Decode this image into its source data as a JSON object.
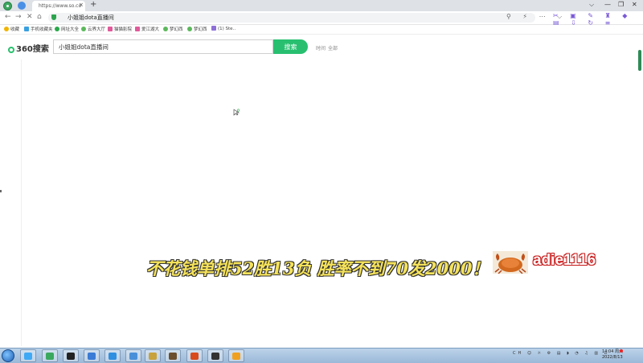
{
  "browser": {
    "tab_title": "https://www.so.co",
    "tab_close": "×",
    "new_tab": "+",
    "address_url": "小姐姐dota直播间",
    "window_controls": [
      "⌵",
      "—",
      "❐",
      "✕"
    ],
    "nav": {
      "back": "←",
      "forward": "→",
      "reload": "✕",
      "home": "⌂"
    },
    "omni_icons": "⚲ ⚡ ⋯ ⌵",
    "toolbar_icons": "✂ ▣ ✎ ♜ ◆ ▤ ⇩ ↻ ≡"
  },
  "bookmarks": [
    {
      "label": "收藏",
      "color": "#f0b400"
    },
    {
      "label": "手机收藏夹",
      "color": "#39a0e0"
    },
    {
      "label": "网址大全",
      "color": "#2aa84a"
    },
    {
      "label": "云界大厅",
      "color": "#5cb85c"
    },
    {
      "label": "猫猫影院",
      "color": "#e05a9a"
    },
    {
      "label": "爱江湖大",
      "color": "#e05a9a"
    },
    {
      "label": "梦幻西",
      "color": "#5cb85c"
    },
    {
      "label": "梦幻西",
      "color": "#5cb85c"
    },
    {
      "label": "(1) Ste..",
      "color": "#8e6fd6"
    }
  ],
  "search": {
    "logo": "360搜索",
    "query": "小姐姐dota直播间",
    "button": "搜索",
    "filter_time": "时间",
    "filter_all": "全部"
  },
  "overlay": {
    "caption": "不花钱单排52胜13负 胜率不到70发2000！",
    "streamer": "adie1116"
  },
  "taskbar": {
    "apps": [
      {
        "icon": "ie-icon",
        "color": "#3fa9f5"
      },
      {
        "icon": "browser-icon",
        "color": "#3ba85f"
      },
      {
        "icon": "media-icon",
        "color": "#222222"
      },
      {
        "icon": "mail-icon",
        "color": "#3a7bd5"
      },
      {
        "icon": "cloud-icon",
        "color": "#2f8fe0"
      },
      {
        "icon": "folder-icon",
        "color": "#4a90d9"
      },
      {
        "icon": "game-icon-1",
        "color": "#c8a23c"
      },
      {
        "icon": "game-icon-2",
        "color": "#6b4e2e"
      },
      {
        "icon": "game-icon-3",
        "color": "#d84a1b"
      },
      {
        "icon": "game-icon-4",
        "color": "#333333"
      },
      {
        "icon": "chat-icon",
        "color": "#f0a020"
      }
    ],
    "tray_text": "CH ☺ ☼ ⚙ ▤ ◗ ◔ ♫ ▥ ⌂",
    "time": "14:04 周六",
    "date": "2022/8/13"
  }
}
